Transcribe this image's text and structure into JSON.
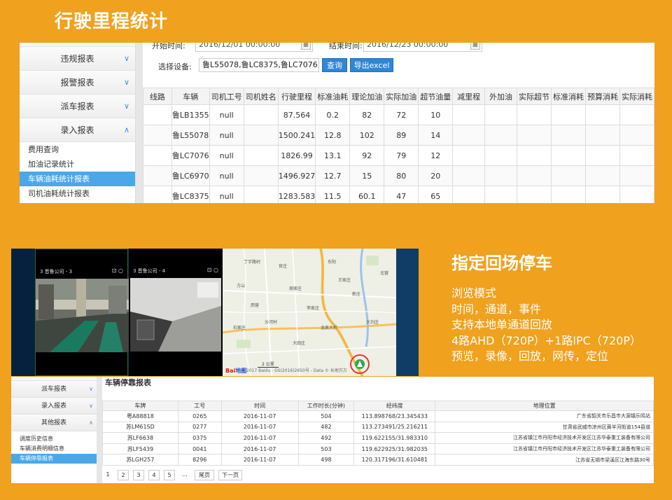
{
  "top_title": "行驶里程统计",
  "mileage_screen": {
    "sidebar": {
      "menus": [
        {
          "label": "违规报表",
          "chevron": "∨"
        },
        {
          "label": "报警报表",
          "chevron": "∨"
        },
        {
          "label": "派车报表",
          "chevron": "∨"
        },
        {
          "label": "录入报表",
          "chevron": "∧"
        }
      ],
      "subitems": [
        "费用查询",
        "加油记录统计",
        "车辆油耗统计报表",
        "司机油耗统计报表"
      ],
      "active_index": 2
    },
    "filters": {
      "start_label": "开始时间:",
      "start_value": "2016/12/01 00:00:00",
      "end_label": "结束时间:",
      "end_value": "2016/12/23 00:00:00",
      "device_label": "选择设备:",
      "device_value": "鲁L55078,鲁LC8375,鲁LC7076,鲁LC",
      "query_label": "查询",
      "export_label": "导出excel"
    },
    "table": {
      "columns": [
        "线路",
        "车辆",
        "司机工号",
        "司机姓名",
        "行驶里程",
        "标准油耗",
        "理论加油",
        "实际加油",
        "超节油量",
        "减里程",
        "外加油",
        "实际超节",
        "标准消耗",
        "预算消耗",
        "实际消耗"
      ],
      "rows": [
        [
          "",
          "鲁LB1355",
          "null",
          "",
          "87.564",
          "0.2",
          "82",
          "72",
          "10",
          "",
          "",
          "",
          "",
          "",
          ""
        ],
        [
          "",
          "鲁L55078",
          "null",
          "",
          "1500.241",
          "12.8",
          "102",
          "89",
          "14",
          "",
          "",
          "",
          "",
          "",
          ""
        ],
        [
          "",
          "鲁LC7076",
          "null",
          "",
          "1826.99",
          "13.1",
          "92",
          "79",
          "12",
          "",
          "",
          "",
          "",
          "",
          ""
        ],
        [
          "",
          "鲁LC6970",
          "null",
          "",
          "1496.927",
          "12.7",
          "15",
          "80",
          "20",
          "",
          "",
          "",
          "",
          "",
          ""
        ],
        [
          "",
          "鲁LC8375",
          "null",
          "",
          "1283.583",
          "11.5",
          "60.1",
          "47",
          "65",
          "",
          "",
          "",
          "",
          "",
          ""
        ]
      ]
    }
  },
  "video_screen": {
    "channels": [
      {
        "label": "3 晋鲁公司 - 3",
        "icons": "⊡ ○"
      },
      {
        "label": "3 晋鲁公司 - 4",
        "icons": "⊡ ○"
      }
    ],
    "map": {
      "brand_red": "Bai",
      "brand_blue": "地图",
      "footer": "© 2017 Baidu - GS(2016)2650号 - Data © 长地万方",
      "scale": "2 公里",
      "labels": [
        "丁字路村",
        "官庄",
        "东阳",
        "方山",
        "周家庄",
        "王家庄",
        "大刘庄",
        "西营",
        "李家庄",
        "沙河村",
        "石家庄",
        "龙泉大桥",
        "大田庄",
        "新庄",
        "北营"
      ]
    }
  },
  "right_text": {
    "title": "指定回场停车",
    "lines": [
      "浏览模式",
      "时间，通道，事件",
      "支持本地单通道回放",
      "4路AHD（720P）+1路IPC（720P）",
      "预览，录像，回放，网传，定位"
    ]
  },
  "parking_screen": {
    "sidebar": {
      "menus": [
        {
          "label": "派车报表",
          "chevron": "∨"
        },
        {
          "label": "录入报表",
          "chevron": "∨"
        },
        {
          "label": "其他报表",
          "chevron": "∧"
        }
      ],
      "subitems": [
        "调度历史信息",
        "车辆消费明细信息",
        "车辆停靠报表"
      ],
      "active_index": 2
    },
    "title": "车辆停靠报表",
    "table": {
      "columns": [
        "车牌",
        "工号",
        "时间",
        "工作时长(分钟)",
        "经纬度",
        "地理位置"
      ],
      "rows": [
        [
          "粤A88818",
          "0265",
          "2016-11-07",
          "504",
          "113.898768/23.345433",
          "广东省韶关市乐昌市大源镇乐鸣站"
        ],
        [
          "苏LM61SD",
          "0277",
          "2016-11-07",
          "482",
          "113.273491/25.216211",
          "甘肃省武威市凉州区黄羊河街道154县道"
        ],
        [
          "苏LF6638",
          "0375",
          "2016-11-07",
          "492",
          "119.622155/31.983310",
          "江苏省镇江市丹阳市经济技术开发区江苏华泰重工装备有限公司"
        ],
        [
          "苏LF5439",
          "0041",
          "2016-11-07",
          "503",
          "119.622925/31.982035",
          "江苏省镇江市丹阳市经济技术开发区江苏华泰重工装备有限公司"
        ],
        [
          "苏LGH257",
          "8296",
          "2016-11-07",
          "498",
          "120.317196/31.610481",
          "江苏省无锡市梁溪区江海东路30号"
        ]
      ]
    },
    "pager": {
      "pages": [
        "1",
        "2",
        "3",
        "4",
        "5"
      ],
      "ellipsis": "...",
      "last": "尾页",
      "next": "下一页"
    }
  }
}
